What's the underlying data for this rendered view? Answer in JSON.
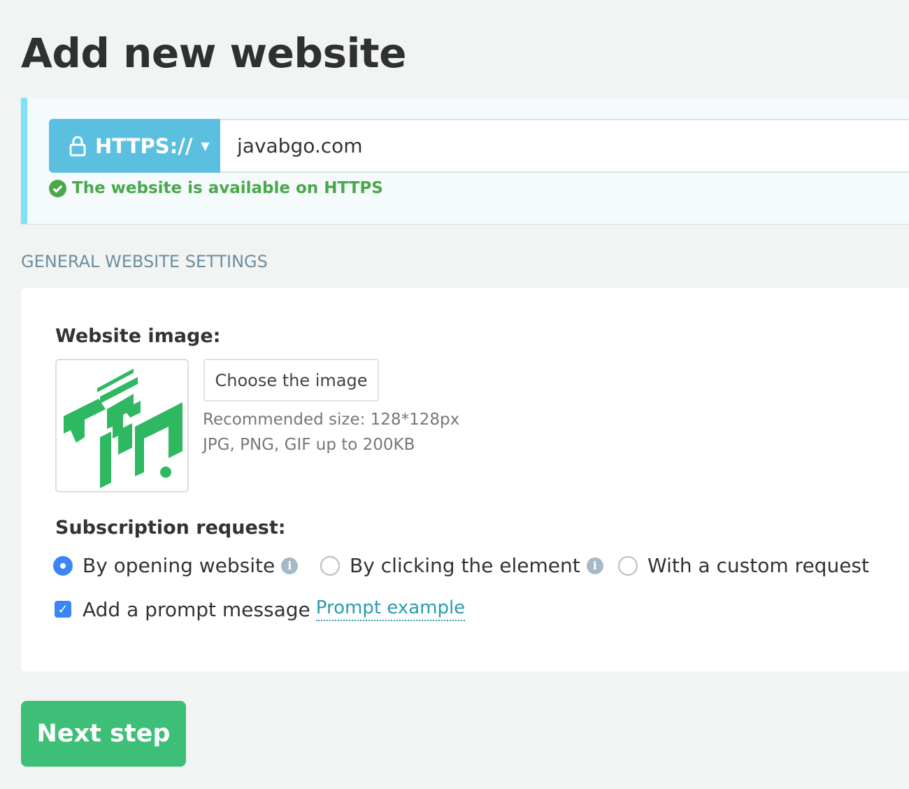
{
  "page": {
    "title": "Add new website"
  },
  "url": {
    "protocol_label": "HTTPS://",
    "value": "javabgo.com",
    "status": "The website is available on HTTPS",
    "status_color": "#4aa84a"
  },
  "settings": {
    "section_title": "GENERAL WEBSITE SETTINGS",
    "image_label": "Website image:",
    "choose_button": "Choose the image",
    "hint_size": "Recommended size: 128*128px",
    "hint_format": "JPG, PNG, GIF up to 200KB",
    "logo_alt": "جواب گو",
    "subscription_label": "Subscription request:",
    "options": [
      {
        "label": "By opening website",
        "selected": true
      },
      {
        "label": "By clicking the element",
        "selected": false
      },
      {
        "label": "With a custom request",
        "selected": false
      }
    ],
    "prompt_checkbox": {
      "label": "Add a prompt message",
      "checked": true
    },
    "prompt_link": "Prompt example"
  },
  "actions": {
    "next": "Next step"
  },
  "colors": {
    "accent": "#5bbfdf",
    "primary_button": "#3dbf77",
    "radio": "#3b86f4"
  }
}
